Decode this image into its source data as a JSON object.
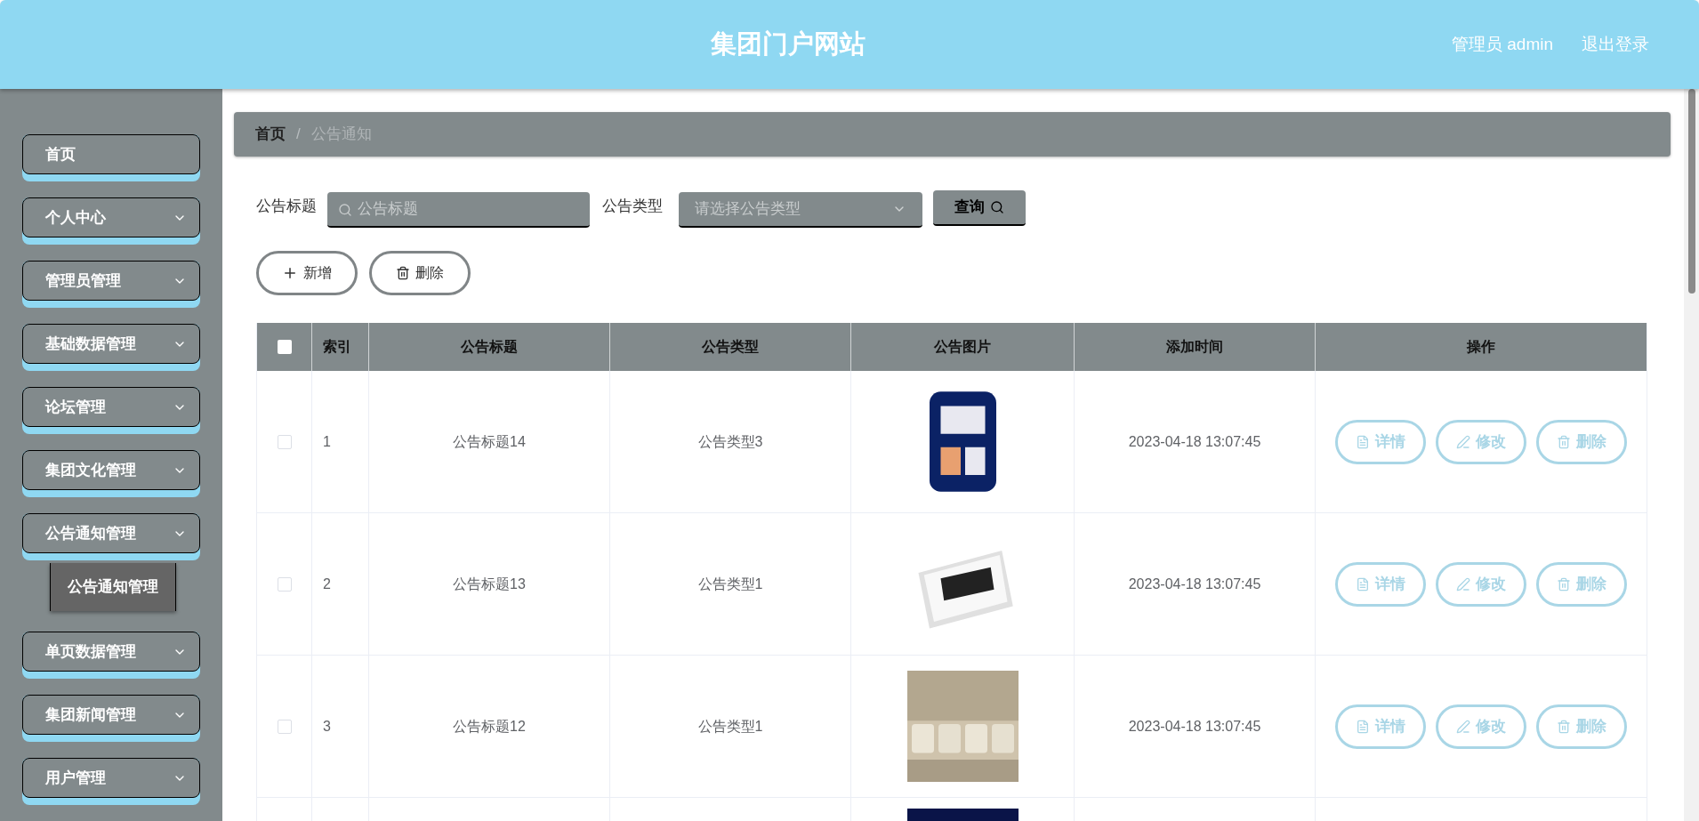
{
  "header": {
    "title": "集团门户网站",
    "user": "管理员 admin",
    "logout": "退出登录"
  },
  "sidebar": {
    "items": [
      {
        "label": "首页",
        "kind": "link"
      },
      {
        "label": "个人中心",
        "kind": "menu"
      },
      {
        "label": "管理员管理",
        "kind": "menu"
      },
      {
        "label": "基础数据管理",
        "kind": "menu"
      },
      {
        "label": "论坛管理",
        "kind": "menu"
      },
      {
        "label": "集团文化管理",
        "kind": "menu"
      },
      {
        "label": "公告通知管理",
        "kind": "menu",
        "children": [
          {
            "label": "公告通知管理"
          }
        ]
      },
      {
        "label": "单页数据管理",
        "kind": "menu"
      },
      {
        "label": "集团新闻管理",
        "kind": "menu"
      },
      {
        "label": "用户管理",
        "kind": "menu"
      }
    ]
  },
  "breadcrumb": [
    "首页",
    "公告通知"
  ],
  "breadcrumb_separator": "/",
  "search": {
    "title_label": "公告标题",
    "title_placeholder": "公告标题",
    "type_label": "公告类型",
    "type_placeholder": "请选择公告类型",
    "query_button": "查询"
  },
  "actions": {
    "add": "新增",
    "delete": "删除"
  },
  "table": {
    "header_checked": false,
    "columns": [
      "索引",
      "公告标题",
      "公告类型",
      "公告图片",
      "添加时间",
      "操作"
    ],
    "rows": [
      {
        "checked": false,
        "index": "1",
        "title": "公告标题14",
        "type": "公告类型3",
        "image": {
          "kind": "picture"
        },
        "time": "2023-04-18 13:07:45",
        "buttons": [
          "详情",
          "修改",
          "删除"
        ]
      },
      {
        "checked": false,
        "index": "2",
        "title": "公告标题13",
        "type": "公告类型1",
        "image": {
          "kind": "picture"
        },
        "time": "2023-04-18 13:07:45",
        "buttons": [
          "详情",
          "修改",
          "删除"
        ]
      },
      {
        "checked": false,
        "index": "3",
        "title": "公告标题12",
        "type": "公告类型1",
        "image": {
          "kind": "picture"
        },
        "time": "2023-04-18 13:07:45",
        "buttons": [
          "详情",
          "修改",
          "删除"
        ]
      },
      {
        "image": {
          "kind": "picture"
        }
      }
    ]
  }
}
